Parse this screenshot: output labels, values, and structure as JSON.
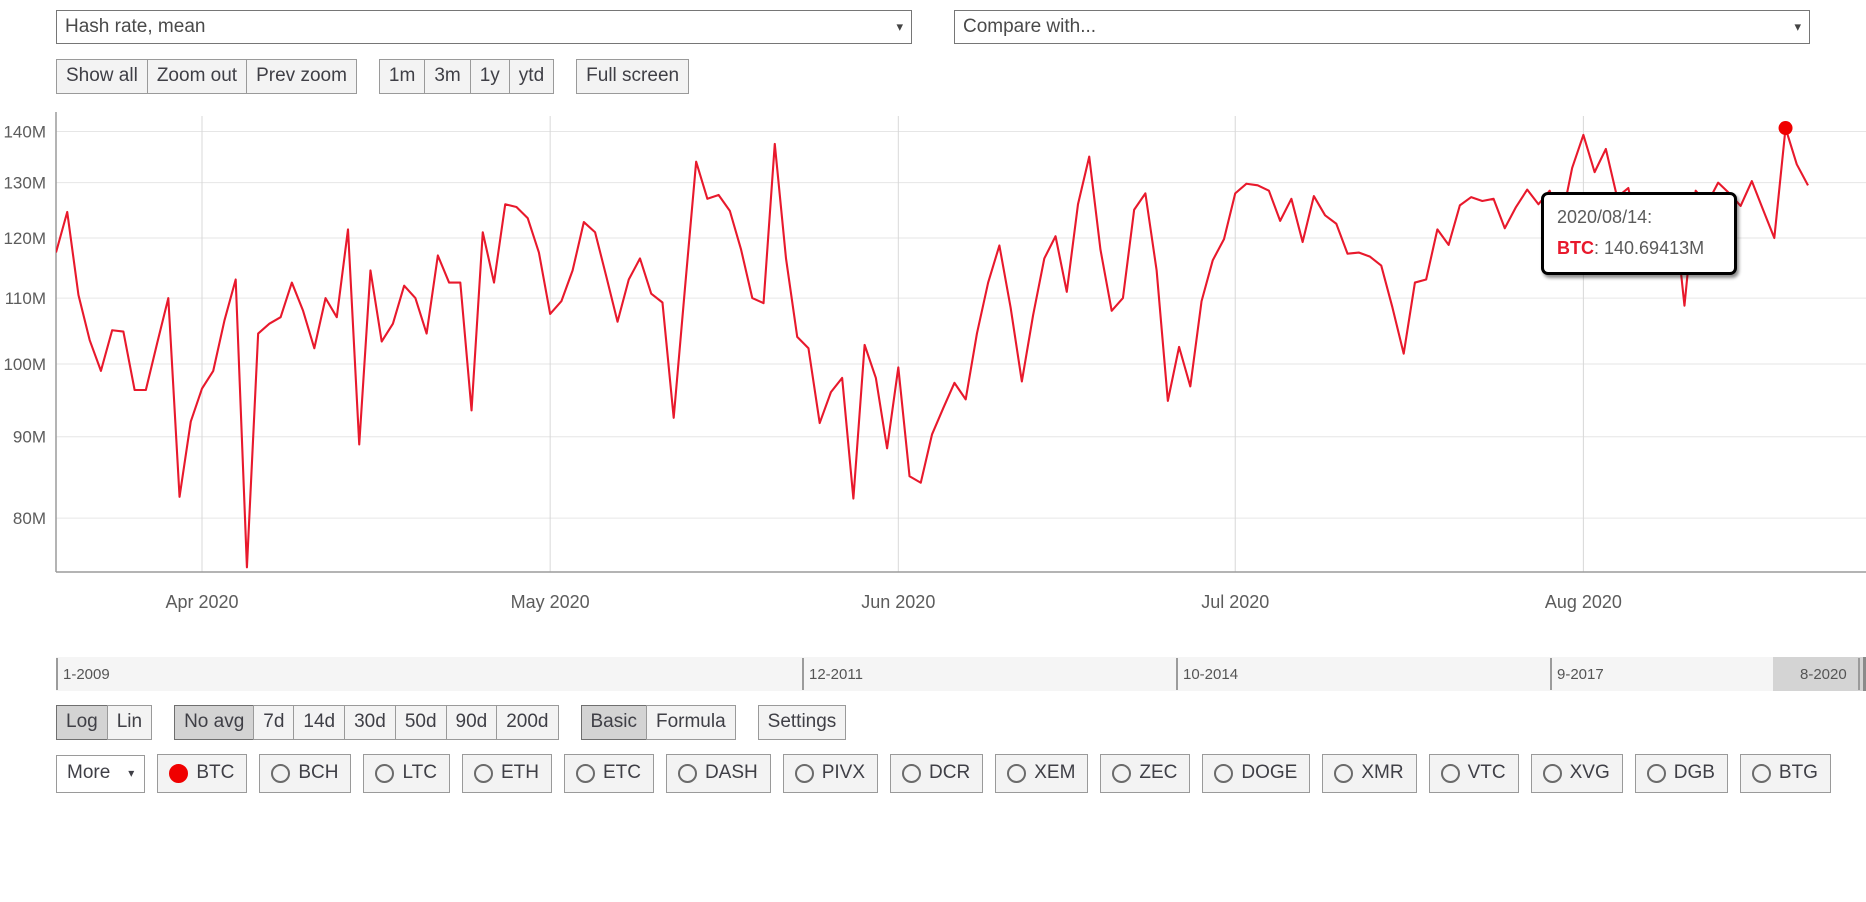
{
  "selectors": {
    "metric": {
      "value": "Hash rate, mean",
      "caret": "chevron-down-icon"
    },
    "compare": {
      "value": "Compare with...",
      "caret": "chevron-down-icon"
    }
  },
  "toolbar": {
    "group1": [
      {
        "label": "Show all",
        "selected": false
      },
      {
        "label": "Zoom out",
        "selected": false
      },
      {
        "label": "Prev zoom",
        "selected": false
      }
    ],
    "group2": [
      {
        "label": "1m",
        "selected": false
      },
      {
        "label": "3m",
        "selected": false
      },
      {
        "label": "1y",
        "selected": false
      },
      {
        "label": "ytd",
        "selected": false
      }
    ],
    "group3": [
      {
        "label": "Full screen",
        "selected": false
      }
    ]
  },
  "tooltip": {
    "date": "2020/08/14:",
    "series": "BTC",
    "separator": ": ",
    "value": "140.69413M",
    "color": "#e8192c"
  },
  "navigator": {
    "labels": [
      "1-2009",
      "12-2011",
      "10-2014",
      "9-2017",
      "8-2020"
    ],
    "selected_range_label": "8-2020"
  },
  "options_row": {
    "scale": [
      {
        "label": "Log",
        "selected": true
      },
      {
        "label": "Lin",
        "selected": false
      }
    ],
    "average": [
      {
        "label": "No avg",
        "selected": true
      },
      {
        "label": "7d",
        "selected": false
      },
      {
        "label": "14d",
        "selected": false
      },
      {
        "label": "30d",
        "selected": false
      },
      {
        "label": "50d",
        "selected": false
      },
      {
        "label": "90d",
        "selected": false
      },
      {
        "label": "200d",
        "selected": false
      }
    ],
    "mode": [
      {
        "label": "Basic",
        "selected": true
      },
      {
        "label": "Formula",
        "selected": false
      }
    ],
    "settings": [
      {
        "label": "Settings",
        "selected": false
      }
    ]
  },
  "coins": {
    "more_label": "More",
    "more_caret": "chevron-down-icon",
    "items": [
      {
        "label": "BTC",
        "selected": true
      },
      {
        "label": "BCH",
        "selected": false
      },
      {
        "label": "LTC",
        "selected": false
      },
      {
        "label": "ETH",
        "selected": false
      },
      {
        "label": "ETC",
        "selected": false
      },
      {
        "label": "DASH",
        "selected": false
      },
      {
        "label": "PIVX",
        "selected": false
      },
      {
        "label": "DCR",
        "selected": false
      },
      {
        "label": "XEM",
        "selected": false
      },
      {
        "label": "ZEC",
        "selected": false
      },
      {
        "label": "DOGE",
        "selected": false
      },
      {
        "label": "XMR",
        "selected": false
      },
      {
        "label": "VTC",
        "selected": false
      },
      {
        "label": "XVG",
        "selected": false
      },
      {
        "label": "DGB",
        "selected": false
      },
      {
        "label": "BTG",
        "selected": false
      }
    ]
  },
  "chart_data": {
    "type": "line",
    "title": "",
    "xlabel": "",
    "ylabel": "Hash rate, mean",
    "series_name": "BTC",
    "color": "#e8192c",
    "y_scale": "log",
    "y_ticks": [
      80,
      90,
      100,
      110,
      120,
      130,
      140
    ],
    "y_tick_labels": [
      "80M",
      "90M",
      "100M",
      "110M",
      "120M",
      "130M",
      "140M"
    ],
    "ylim": [
      74,
      144
    ],
    "y_unit": "M",
    "grid": true,
    "legend": "none",
    "x_tick_labels": [
      "Apr 2020",
      "May 2020",
      "Jun 2020",
      "Jul 2020",
      "Aug 2020"
    ],
    "x_range": [
      "2020-03-19",
      "2020-08-17"
    ],
    "highlight_point": {
      "date": "2020/08/14",
      "value": 140.69413,
      "label": "140.69413M"
    },
    "x": [
      "2020-03-19",
      "2020-03-20",
      "2020-03-21",
      "2020-03-22",
      "2020-03-23",
      "2020-03-24",
      "2020-03-25",
      "2020-03-26",
      "2020-03-27",
      "2020-03-28",
      "2020-03-29",
      "2020-03-30",
      "2020-03-31",
      "2020-04-01",
      "2020-04-02",
      "2020-04-03",
      "2020-04-04",
      "2020-04-05",
      "2020-04-06",
      "2020-04-07",
      "2020-04-08",
      "2020-04-09",
      "2020-04-10",
      "2020-04-11",
      "2020-04-12",
      "2020-04-13",
      "2020-04-14",
      "2020-04-15",
      "2020-04-16",
      "2020-04-17",
      "2020-04-18",
      "2020-04-19",
      "2020-04-20",
      "2020-04-21",
      "2020-04-22",
      "2020-04-23",
      "2020-04-24",
      "2020-04-25",
      "2020-04-26",
      "2020-04-27",
      "2020-04-28",
      "2020-04-29",
      "2020-04-30",
      "2020-05-01",
      "2020-05-02",
      "2020-05-03",
      "2020-05-04",
      "2020-05-05",
      "2020-05-06",
      "2020-05-07",
      "2020-05-08",
      "2020-05-09",
      "2020-05-10",
      "2020-05-11",
      "2020-05-12",
      "2020-05-13",
      "2020-05-14",
      "2020-05-15",
      "2020-05-16",
      "2020-05-17",
      "2020-05-18",
      "2020-05-19",
      "2020-05-20",
      "2020-05-21",
      "2020-05-22",
      "2020-05-23",
      "2020-05-24",
      "2020-05-25",
      "2020-05-26",
      "2020-05-27",
      "2020-05-28",
      "2020-05-29",
      "2020-05-30",
      "2020-05-31",
      "2020-06-01",
      "2020-06-02",
      "2020-06-03",
      "2020-06-04",
      "2020-06-05",
      "2020-06-06",
      "2020-06-07",
      "2020-06-08",
      "2020-06-09",
      "2020-06-10",
      "2020-06-11",
      "2020-06-12",
      "2020-06-13",
      "2020-06-14",
      "2020-06-15",
      "2020-06-16",
      "2020-06-17",
      "2020-06-18",
      "2020-06-19",
      "2020-06-20",
      "2020-06-21",
      "2020-06-22",
      "2020-06-23",
      "2020-06-24",
      "2020-06-25",
      "2020-06-26",
      "2020-06-27",
      "2020-06-28",
      "2020-06-29",
      "2020-06-30",
      "2020-07-01",
      "2020-07-02",
      "2020-07-03",
      "2020-07-04",
      "2020-07-05",
      "2020-07-06",
      "2020-07-07",
      "2020-07-08",
      "2020-07-09",
      "2020-07-10",
      "2020-07-11",
      "2020-07-12",
      "2020-07-13",
      "2020-07-14",
      "2020-07-15",
      "2020-07-16",
      "2020-07-17",
      "2020-07-18",
      "2020-07-19",
      "2020-07-20",
      "2020-07-21",
      "2020-07-22",
      "2020-07-23",
      "2020-07-24",
      "2020-07-25",
      "2020-07-26",
      "2020-07-27",
      "2020-07-28",
      "2020-07-29",
      "2020-07-30",
      "2020-07-31",
      "2020-08-01",
      "2020-08-02",
      "2020-08-03",
      "2020-08-04",
      "2020-08-05",
      "2020-08-06",
      "2020-08-07",
      "2020-08-08",
      "2020-08-09",
      "2020-08-10",
      "2020-08-11",
      "2020-08-12",
      "2020-08-13",
      "2020-08-14",
      "2020-08-15",
      "2020-08-16"
    ],
    "values": [
      117.5,
      124.6,
      110.5,
      103.5,
      99.0,
      105.0,
      104.8,
      96.3,
      96.3,
      103.0,
      110.0,
      82.5,
      92.0,
      96.5,
      99.0,
      106.5,
      113.0,
      74.5,
      104.5,
      106.0,
      107.0,
      112.5,
      108.0,
      102.3,
      110.0,
      107.0,
      121.5,
      89.0,
      114.5,
      103.3,
      106.0,
      112.0,
      110.0,
      104.5,
      117.0,
      112.5,
      112.5,
      93.5,
      121.0,
      112.5,
      126.0,
      125.5,
      123.5,
      117.5,
      107.5,
      109.5,
      114.5,
      122.8,
      121.0,
      113.5,
      106.3,
      113.0,
      116.5,
      110.7,
      109.3,
      92.5,
      111.5,
      134.0,
      127.0,
      127.7,
      124.8,
      118.0,
      110.0,
      109.2,
      137.5,
      116.5,
      104.0,
      102.3,
      91.8,
      96.0,
      98.0,
      82.3,
      102.8,
      98.0,
      88.5,
      99.5,
      85.0,
      84.2,
      90.3,
      93.8,
      97.3,
      95.0,
      104.5,
      112.5,
      118.7,
      108.5,
      97.5,
      107.3,
      116.5,
      120.3,
      111.0,
      126.0,
      135.0,
      118.0,
      108.0,
      110.0,
      125.0,
      128.0,
      114.5,
      94.8,
      102.5,
      96.8,
      109.5,
      116.2,
      119.8,
      128.0,
      129.8,
      129.5,
      128.5,
      123.0,
      127.0,
      119.3,
      127.5,
      124.0,
      122.5,
      117.3,
      117.5,
      116.8,
      115.3,
      108.5,
      101.5,
      112.5,
      113.0,
      121.5,
      118.8,
      125.8,
      127.3,
      126.6,
      127.0,
      121.7,
      125.5,
      128.7,
      126.0,
      128.5,
      122.6,
      132.8,
      139.3,
      132.0,
      136.5,
      127.3,
      129.0,
      119.5,
      124.7,
      115.5,
      127.0,
      108.8,
      128.5,
      126.0,
      130.0,
      128.0,
      125.7,
      130.3,
      125.0,
      120.0,
      140.69413,
      133.5,
      129.5
    ]
  }
}
